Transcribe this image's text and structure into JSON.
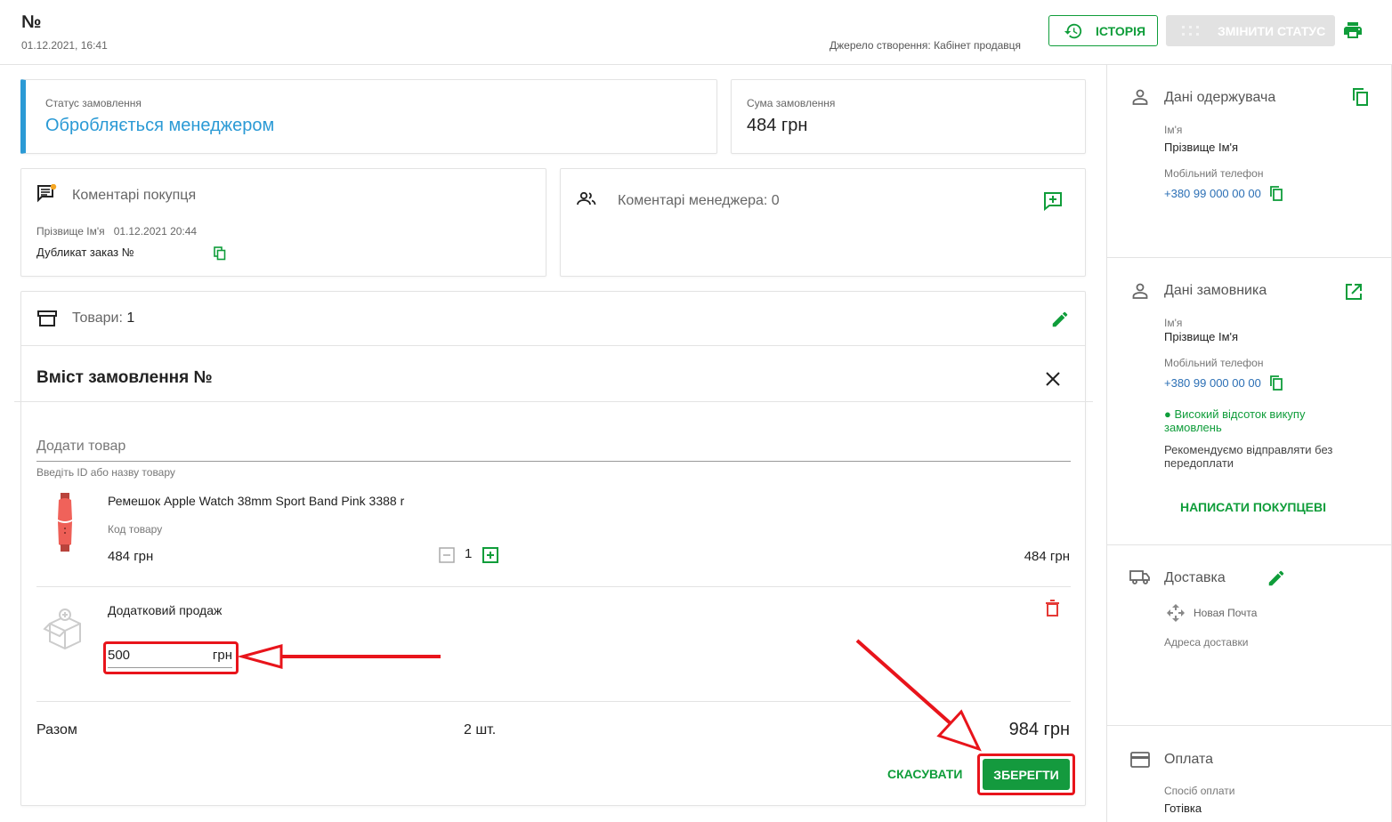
{
  "header": {
    "order_no": "№",
    "order_date": "01.12.2021, 16:41",
    "source": "Джерело створення: Кабінет продавця",
    "history_label": "ІСТОРІЯ",
    "change_status_label": "ЗМІНИТИ СТАТУС"
  },
  "status_card": {
    "label": "Статус замовлення",
    "value": "Обробляється менеджером"
  },
  "sum_card": {
    "label": "Сума замовлення",
    "value": "484 грн"
  },
  "buyer_comments": {
    "title": "Коментарі покупця",
    "author": "Прізвище Ім'я",
    "date": "01.12.2021 20:44",
    "text": "Дубликат заказ №"
  },
  "manager_comments": {
    "title": "Коментарі менеджера: 0"
  },
  "goods": {
    "title_prefix": "Товари: ",
    "count": "1",
    "content_title": "Вміст замовлення №",
    "add_product_placeholder": "Додати товар",
    "add_product_hint": "Введіть ID або назву товару",
    "product": {
      "name": "Ремешок Apple Watch 38mm Sport Band Pink 3388 r",
      "code_label": "Код товару",
      "price": "484 грн",
      "qty": "1",
      "total": "484 грн"
    },
    "extra_sale": {
      "label": "Додатковий продаж",
      "value": "500",
      "currency": "грн"
    },
    "summary": {
      "label": "Разом",
      "qty": "2 шт.",
      "total": "984 грн"
    },
    "cancel_label": "СКАСУВАТИ",
    "save_label": "ЗБЕРЕГТИ"
  },
  "recipient": {
    "title": "Дані одержувача",
    "name_label": "Ім'я",
    "name": "Прізвище Ім'я",
    "phone_label": "Мобільний телефон",
    "phone": "+380 99 000 00 00"
  },
  "customer": {
    "title": "Дані замовника",
    "name_label": "Ім'я",
    "name": "Прізвище Ім'я",
    "phone_label": "Мобільний телефон",
    "phone": "+380 99 000 00 00",
    "badge": "Високий відсоток викупу замовлень",
    "recommendation": "Рекомендуємо відправляти без передоплати",
    "write_button": "НАПИСАТИ ПОКУПЦЕВІ"
  },
  "delivery": {
    "title": "Доставка",
    "carrier": "Новая Почта",
    "address_label": "Адреса доставки"
  },
  "payment": {
    "title": "Оплата",
    "method_label": "Спосіб оплати",
    "method": "Готівка"
  },
  "colors": {
    "accent_green": "#0f9d3a",
    "status_blue": "#2b9ad5",
    "annotation_red": "#e8141b",
    "delete_red": "#e53935"
  },
  "icons": [
    "history-icon",
    "status-icon",
    "print-icon",
    "comment-icon",
    "managers-icon",
    "add-comment-icon",
    "box-icon",
    "edit-icon",
    "close-icon",
    "minus-icon",
    "plus-icon",
    "delete-icon",
    "person-icon",
    "copy-icon",
    "open-external-icon",
    "truck-icon",
    "card-icon"
  ]
}
